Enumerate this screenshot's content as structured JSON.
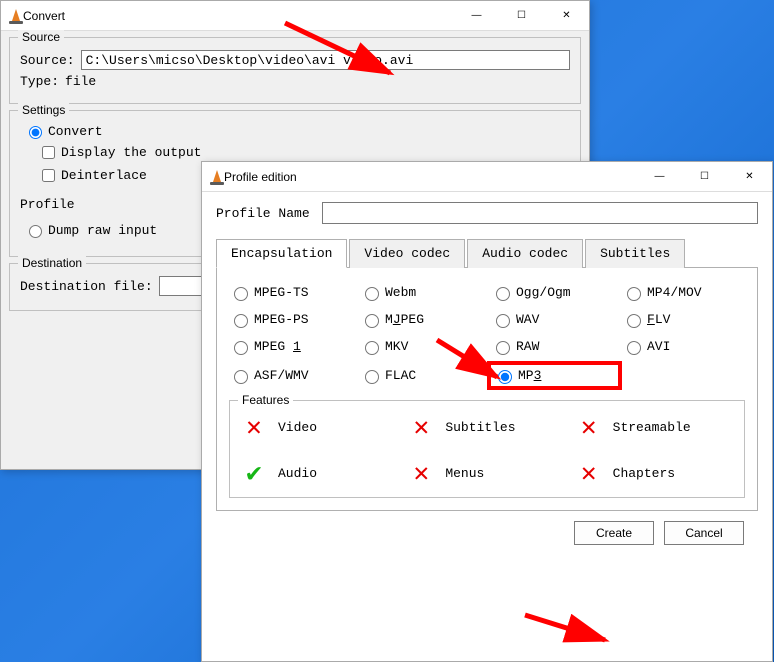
{
  "convert": {
    "title": "Convert",
    "source_group": "Source",
    "source_label": "Source:",
    "source_value": "C:\\Users\\micso\\Desktop\\video\\avi video.avi",
    "type_label": "Type:",
    "type_value": "file",
    "settings_group": "Settings",
    "convert_radio": "Convert",
    "display_output": "Display the output",
    "deinterlace": "Deinterlace",
    "profile_label": "Profile",
    "dump_raw": "Dump raw input",
    "destination_group": "Destination",
    "destination_label": "Destination file:"
  },
  "profile": {
    "title": "Profile edition",
    "name_label": "Profile Name",
    "name_value": "",
    "tabs": {
      "encapsulation": "Encapsulation",
      "video": "Video codec",
      "audio": "Audio codec",
      "subtitles": "Subtitles"
    },
    "enc": {
      "mpegts": "MPEG-TS",
      "webm": "Webm",
      "ogg": "Ogg/Ogm",
      "mp4": "MP4/MOV",
      "mpegps": "MPEG-PS",
      "mjpeg": "MJPEG",
      "wav": "WAV",
      "flv": "FLV",
      "mpeg1_pre": "MPEG ",
      "mpeg1_u": "1",
      "mkv": "MKV",
      "raw": "RAW",
      "avi": "AVI",
      "asf": "ASF/WMV",
      "flac": "FLAC",
      "mp3_pre": "MP",
      "mp3_u": "3"
    },
    "features_group": "Features",
    "features": {
      "video": "Video",
      "subtitles": "Subtitles",
      "streamable": "Streamable",
      "audio": "Audio",
      "menus": "Menus",
      "chapters": "Chapters"
    },
    "create": "Create",
    "cancel": "Cancel"
  }
}
